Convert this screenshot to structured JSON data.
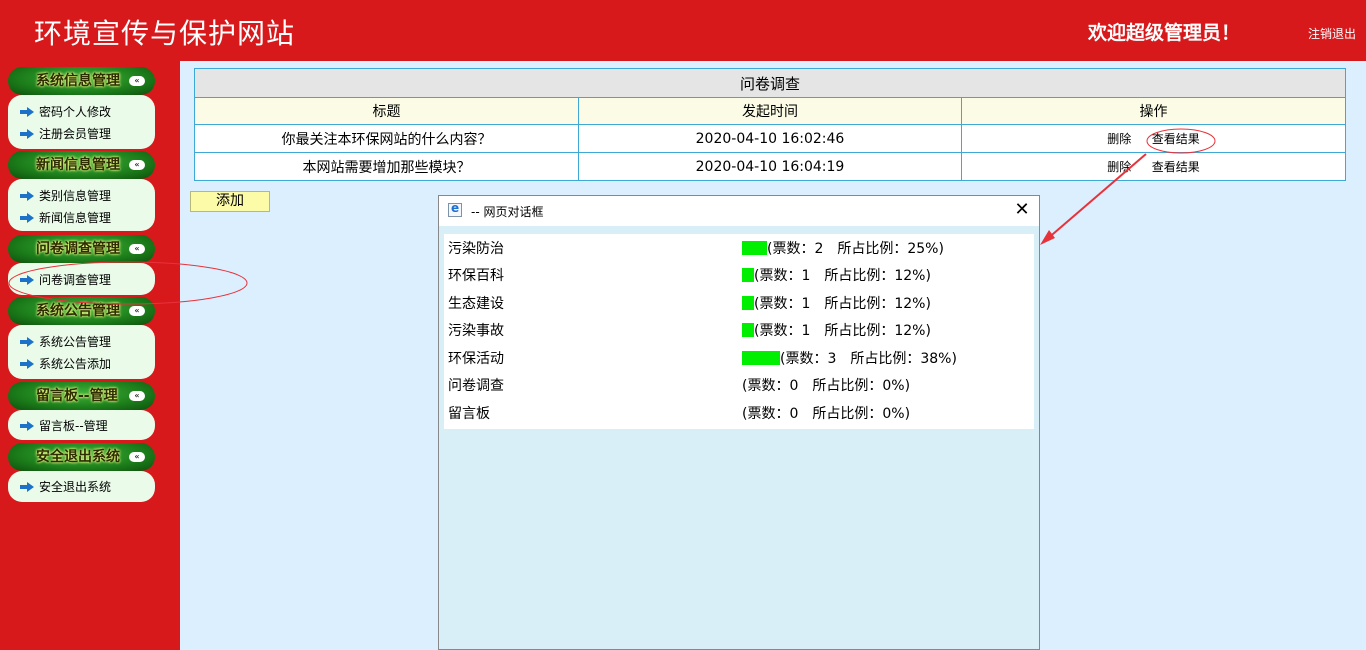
{
  "header": {
    "site_title": "环境宣传与保护网站",
    "welcome": "欢迎超级管理员！",
    "logout": "注销退出"
  },
  "sidebar": {
    "sections": [
      {
        "title": "系统信息管理",
        "items": [
          "密码个人修改",
          "注册会员管理"
        ]
      },
      {
        "title": "新闻信息管理",
        "items": [
          "类别信息管理",
          "新闻信息管理"
        ]
      },
      {
        "title": "问卷调查管理",
        "items": [
          "问卷调查管理"
        ]
      },
      {
        "title": "系统公告管理",
        "items": [
          "系统公告管理",
          "系统公告添加"
        ]
      },
      {
        "title": "留言板--管理",
        "items": [
          "留言板--管理"
        ]
      },
      {
        "title": "安全退出系统",
        "items": [
          "安全退出系统"
        ]
      }
    ],
    "collapse_glyph": "«"
  },
  "survey_table": {
    "caption": "问卷调查",
    "columns": [
      "标题",
      "发起时间",
      "操作"
    ],
    "rows": [
      {
        "title": "你最关注本环保网站的什么内容？",
        "time": "2020-04-10 16:02:46",
        "delete": "删除",
        "view": "查看结果"
      },
      {
        "title": "本网站需要增加那些模块？",
        "time": "2020-04-10 16:04:19",
        "delete": "删除",
        "view": "查看结果"
      }
    ]
  },
  "add_button": "添加",
  "dialog": {
    "title": "-- 网页对话框",
    "close_glyph": "✕",
    "results": [
      {
        "option": "污染防治",
        "votes_text": "(票数：2　所占比例：25%)",
        "percent": 25
      },
      {
        "option": "环保百科",
        "votes_text": "(票数：1　所占比例：12%)",
        "percent": 12
      },
      {
        "option": "生态建设",
        "votes_text": "(票数：1　所占比例：12%)",
        "percent": 12
      },
      {
        "option": "污染事故",
        "votes_text": "(票数：1　所占比例：12%)",
        "percent": 12
      },
      {
        "option": "环保活动",
        "votes_text": "(票数：3　所占比例：38%)",
        "percent": 38
      },
      {
        "option": "问卷调查",
        "votes_text": "(票数：0　所占比例：0%)",
        "percent": 0
      },
      {
        "option": "留言板",
        "votes_text": "(票数：0　所占比例：0%)",
        "percent": 0
      }
    ]
  },
  "colors": {
    "header_red": "#d7191c",
    "page_bg": "#dcefff",
    "vote_bar": "#00ee00",
    "table_border": "#3fa9d6",
    "annotation_red": "#e8323a"
  },
  "icons": {
    "nav_arrow": "arrow-right-icon",
    "dialog_icon": "ie-page-icon",
    "close": "close-icon"
  }
}
